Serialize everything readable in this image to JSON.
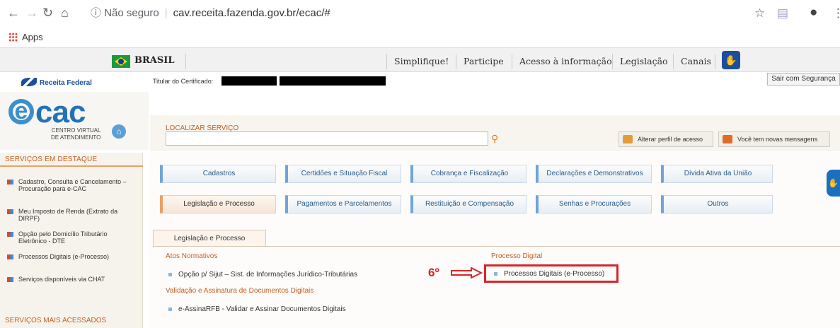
{
  "browser": {
    "url_warning": "Não seguro",
    "url": "cav.receita.fazenda.gov.br/ecac/#",
    "apps_label": "Apps",
    "icons": [
      "back-icon",
      "forward-icon",
      "reload-icon",
      "home-icon",
      "info-icon",
      "star-icon",
      "extension-icon",
      "profile-icon",
      "menu-icon"
    ]
  },
  "govbar": {
    "country": "BRASIL",
    "links": [
      "Simplifique!",
      "Participe",
      "Acesso à informação",
      "Legislação",
      "Canais"
    ]
  },
  "header": {
    "rf_logo": "Receita Federal",
    "ecac_logo": "cac",
    "ecac_subtitle_1": "CENTRO VIRTUAL",
    "ecac_subtitle_2": "DE ATENDIMENTO",
    "titular_label": "Titular do Certificado:",
    "sair": "Sair com Segurança",
    "search_label": "LOCALIZAR SERVIÇO",
    "search_value": "",
    "btn_perfil": "Alterar perfil de acesso",
    "btn_mensagens": "Você tem novas mensagens"
  },
  "sidebar": {
    "destaque_title": "SERVIÇOS EM DESTAQUE",
    "items": [
      "Cadastro, Consulta e Cancelamento – Procuração para e-CAC",
      "Meu Imposto de Renda (Extrato da DIRPF)",
      "Opção pelo Domicílio Tributário Eletrônico - DTE",
      "Processos Digitais (e-Processo)",
      "Serviços disponíveis via CHAT"
    ],
    "mais_title": "SERVIÇOS MAIS ACESSADOS"
  },
  "tabs": {
    "row1": [
      "Cadastros",
      "Certidões e Situação Fiscal",
      "Cobrança e Fiscalização",
      "Declarações e Demonstrativos",
      "Dívida Ativa da União"
    ],
    "row2": [
      "Legislação e Processo",
      "Pagamentos e Parcelamentos",
      "Restituição e Compensação",
      "Senhas e Procurações",
      "Outros"
    ],
    "active": "Legislação e Processo"
  },
  "panel": {
    "subtab": "Legislação e Processo",
    "atos_title": "Atos Normativos",
    "atos_item": "Opção p/ Sijut – Sist. de Informações Jurídico-Tributárias",
    "validacao_title": "Validação e Assinatura de Documentos Digitais",
    "validacao_item": "e-AssinaRFB - Validar e Assinar Documentos Digitais",
    "processo_title": "Processo Digital",
    "processo_item": "Processos Digitais (e-Processo)"
  },
  "annotation": {
    "step": "6º",
    "color": "#d4262a"
  }
}
